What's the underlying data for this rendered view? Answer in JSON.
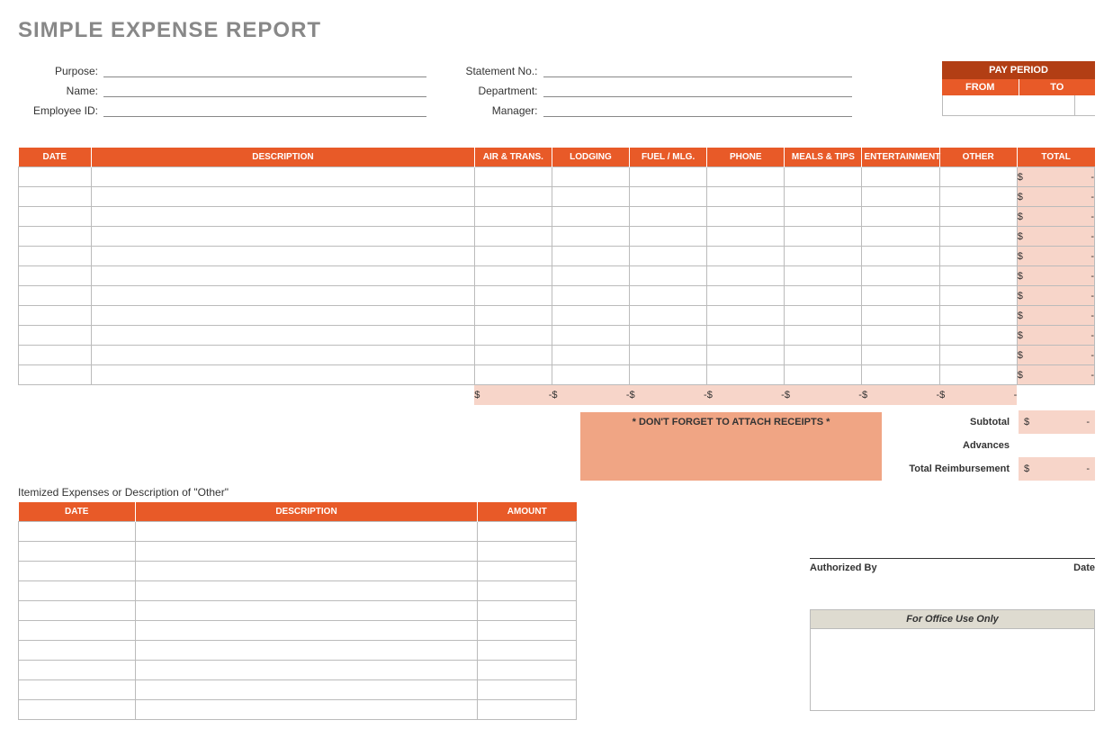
{
  "title": "SIMPLE EXPENSE REPORT",
  "fields": {
    "purpose_label": "Purpose:",
    "name_label": "Name:",
    "employee_id_label": "Employee ID:",
    "statement_no_label": "Statement No.:",
    "department_label": "Department:",
    "manager_label": "Manager:"
  },
  "pay_period": {
    "title": "PAY PERIOD",
    "from_label": "FROM",
    "to_label": "TO"
  },
  "main_table": {
    "headers": {
      "date": "DATE",
      "description": "DESCRIPTION",
      "air_trans": "AIR & TRANS.",
      "lodging": "LODGING",
      "fuel_mlg": "FUEL / MLG.",
      "phone": "PHONE",
      "meals_tips": "MEALS & TIPS",
      "entertainment": "ENTERTAINMENT",
      "other": "OTHER",
      "total": "TOTAL"
    },
    "row_count": 11,
    "currency_symbol": "$",
    "dash": "-"
  },
  "receipts_note": "* DON'T FORGET TO ATTACH RECEIPTS *",
  "summary": {
    "subtotal_label": "Subtotal",
    "advances_label": "Advances",
    "total_reimb_label": "Total Reimbursement",
    "currency_symbol": "$",
    "dash": "-"
  },
  "itemized": {
    "caption": "Itemized Expenses or Description of \"Other\"",
    "headers": {
      "date": "DATE",
      "description": "DESCRIPTION",
      "amount": "AMOUNT"
    },
    "row_count": 10
  },
  "signature": {
    "auth_label": "Authorized By",
    "date_label": "Date"
  },
  "office": {
    "header": "For Office Use Only"
  }
}
